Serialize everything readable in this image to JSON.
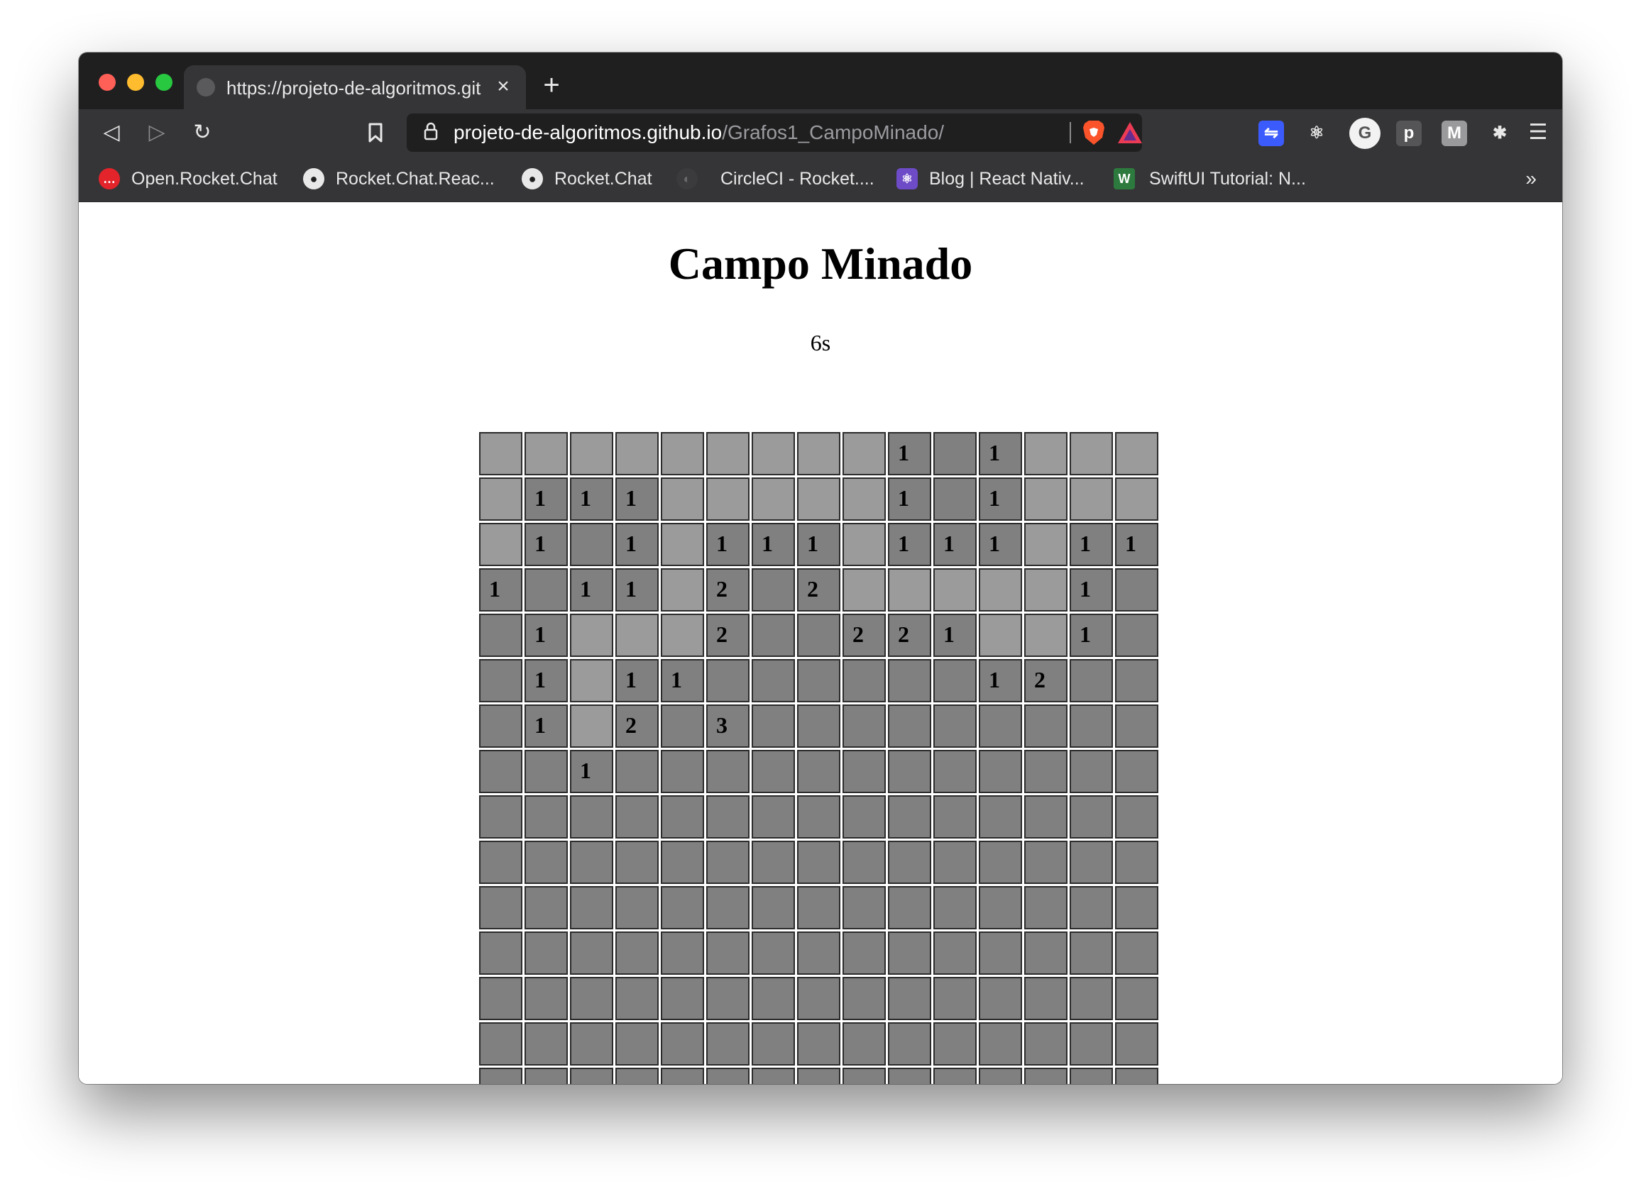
{
  "browser": {
    "tab_title": "https://projeto-de-algoritmos.github.io/Grafos1_CampoMinado/",
    "tab_close": "×",
    "new_tab": "+",
    "url_host": "projeto-de-algoritmos.github.io",
    "url_path": "/Grafos1_CampoMinado/",
    "back": "◁",
    "forward": "▷",
    "reload": "↻",
    "bookmark": "☐",
    "lock": "🔒",
    "extensions_menu": "☰",
    "bookmarks_more": "»",
    "bookmarks": [
      {
        "label": "Open.Rocket.Chat",
        "icon": "rocket-chat-icon"
      },
      {
        "label": "Rocket.Chat.Reac...",
        "icon": "github-icon"
      },
      {
        "label": "Rocket.Chat",
        "icon": "github-icon"
      },
      {
        "label": "CircleCI - Rocket....",
        "icon": "circleci-icon"
      },
      {
        "label": "Blog | React Nativ...",
        "icon": "react-icon"
      },
      {
        "label": "SwiftUI Tutorial: N...",
        "icon": "swiftui-icon"
      }
    ],
    "extensions": [
      {
        "name": "link-extension-icon",
        "glyph": "⇋"
      },
      {
        "name": "react-devtools-icon",
        "glyph": "⚛"
      },
      {
        "name": "grammar-extension-icon",
        "glyph": "G"
      },
      {
        "name": "p-extension-icon",
        "glyph": "p"
      },
      {
        "name": "m-extension-icon",
        "glyph": "M"
      },
      {
        "name": "puzzle-icon",
        "glyph": "✱"
      }
    ]
  },
  "page": {
    "title": "Campo Minado",
    "timer": "6s"
  },
  "board": {
    "rows": 15,
    "cols": 15,
    "colors": {
      "covered": "#808080",
      "open": "#9b9b9b"
    },
    "cells": [
      [
        "o",
        "o",
        "o",
        "o",
        "o",
        "o",
        "o",
        "o",
        "o",
        "1",
        "c",
        "1",
        "o",
        "o",
        "o"
      ],
      [
        "o",
        "1",
        "1",
        "1",
        "o",
        "o",
        "o",
        "o",
        "o",
        "1",
        "c",
        "1",
        "o",
        "o",
        "o"
      ],
      [
        "o",
        "1",
        "c",
        "1",
        "o",
        "1",
        "1",
        "1",
        "o",
        "1",
        "1",
        "1",
        "o",
        "1",
        "1"
      ],
      [
        "1",
        "c",
        "1",
        "1",
        "o",
        "2",
        "c",
        "2",
        "o",
        "o",
        "o",
        "o",
        "o",
        "1",
        "c"
      ],
      [
        "c",
        "1",
        "o",
        "o",
        "o",
        "2",
        "c",
        "c",
        "2",
        "2",
        "1",
        "o",
        "o",
        "1",
        "c"
      ],
      [
        "c",
        "1",
        "o",
        "1",
        "1",
        "c",
        "c",
        "c",
        "c",
        "c",
        "c",
        "1",
        "2",
        "c",
        "c"
      ],
      [
        "c",
        "1",
        "o",
        "2",
        "c",
        "3",
        "c",
        "c",
        "c",
        "c",
        "c",
        "c",
        "c",
        "c",
        "c"
      ],
      [
        "c",
        "c",
        "1",
        "c",
        "c",
        "c",
        "c",
        "c",
        "c",
        "c",
        "c",
        "c",
        "c",
        "c",
        "c"
      ],
      [
        "c",
        "c",
        "c",
        "c",
        "c",
        "c",
        "c",
        "c",
        "c",
        "c",
        "c",
        "c",
        "c",
        "c",
        "c"
      ],
      [
        "c",
        "c",
        "c",
        "c",
        "c",
        "c",
        "c",
        "c",
        "c",
        "c",
        "c",
        "c",
        "c",
        "c",
        "c"
      ],
      [
        "c",
        "c",
        "c",
        "c",
        "c",
        "c",
        "c",
        "c",
        "c",
        "c",
        "c",
        "c",
        "c",
        "c",
        "c"
      ],
      [
        "c",
        "c",
        "c",
        "c",
        "c",
        "c",
        "c",
        "c",
        "c",
        "c",
        "c",
        "c",
        "c",
        "c",
        "c"
      ],
      [
        "c",
        "c",
        "c",
        "c",
        "c",
        "c",
        "c",
        "c",
        "c",
        "c",
        "c",
        "c",
        "c",
        "c",
        "c"
      ],
      [
        "c",
        "c",
        "c",
        "c",
        "c",
        "c",
        "c",
        "c",
        "c",
        "c",
        "c",
        "c",
        "c",
        "c",
        "c"
      ],
      [
        "c",
        "c",
        "c",
        "c",
        "c",
        "c",
        "c",
        "c",
        "c",
        "c",
        "c",
        "c",
        "c",
        "c",
        "c"
      ]
    ]
  }
}
